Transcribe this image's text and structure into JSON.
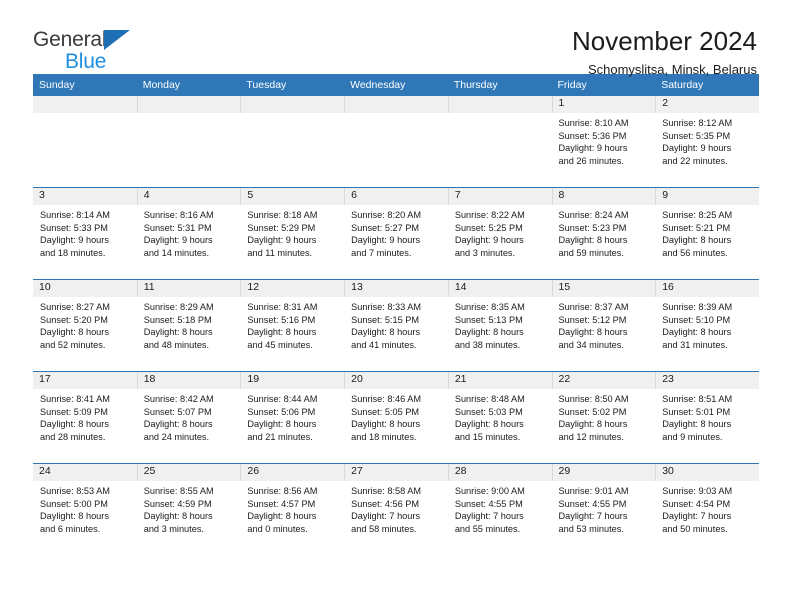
{
  "brand": {
    "name_part1": "General",
    "name_part2": "Blue",
    "accent_color": "#1f6fb5",
    "blue_text_color": "#1f8fe0"
  },
  "header": {
    "title": "November 2024",
    "location": "Schomyslitsa, Minsk, Belarus"
  },
  "calendar": {
    "header_color": "#3077b8",
    "weekdays": [
      "Sunday",
      "Monday",
      "Tuesday",
      "Wednesday",
      "Thursday",
      "Friday",
      "Saturday"
    ],
    "weeks": [
      [
        {
          "day": "",
          "sunrise": "",
          "sunset": "",
          "daylight_1": "",
          "daylight_2": ""
        },
        {
          "day": "",
          "sunrise": "",
          "sunset": "",
          "daylight_1": "",
          "daylight_2": ""
        },
        {
          "day": "",
          "sunrise": "",
          "sunset": "",
          "daylight_1": "",
          "daylight_2": ""
        },
        {
          "day": "",
          "sunrise": "",
          "sunset": "",
          "daylight_1": "",
          "daylight_2": ""
        },
        {
          "day": "",
          "sunrise": "",
          "sunset": "",
          "daylight_1": "",
          "daylight_2": ""
        },
        {
          "day": "1",
          "sunrise": "Sunrise: 8:10 AM",
          "sunset": "Sunset: 5:36 PM",
          "daylight_1": "Daylight: 9 hours",
          "daylight_2": "and 26 minutes."
        },
        {
          "day": "2",
          "sunrise": "Sunrise: 8:12 AM",
          "sunset": "Sunset: 5:35 PM",
          "daylight_1": "Daylight: 9 hours",
          "daylight_2": "and 22 minutes."
        }
      ],
      [
        {
          "day": "3",
          "sunrise": "Sunrise: 8:14 AM",
          "sunset": "Sunset: 5:33 PM",
          "daylight_1": "Daylight: 9 hours",
          "daylight_2": "and 18 minutes."
        },
        {
          "day": "4",
          "sunrise": "Sunrise: 8:16 AM",
          "sunset": "Sunset: 5:31 PM",
          "daylight_1": "Daylight: 9 hours",
          "daylight_2": "and 14 minutes."
        },
        {
          "day": "5",
          "sunrise": "Sunrise: 8:18 AM",
          "sunset": "Sunset: 5:29 PM",
          "daylight_1": "Daylight: 9 hours",
          "daylight_2": "and 11 minutes."
        },
        {
          "day": "6",
          "sunrise": "Sunrise: 8:20 AM",
          "sunset": "Sunset: 5:27 PM",
          "daylight_1": "Daylight: 9 hours",
          "daylight_2": "and 7 minutes."
        },
        {
          "day": "7",
          "sunrise": "Sunrise: 8:22 AM",
          "sunset": "Sunset: 5:25 PM",
          "daylight_1": "Daylight: 9 hours",
          "daylight_2": "and 3 minutes."
        },
        {
          "day": "8",
          "sunrise": "Sunrise: 8:24 AM",
          "sunset": "Sunset: 5:23 PM",
          "daylight_1": "Daylight: 8 hours",
          "daylight_2": "and 59 minutes."
        },
        {
          "day": "9",
          "sunrise": "Sunrise: 8:25 AM",
          "sunset": "Sunset: 5:21 PM",
          "daylight_1": "Daylight: 8 hours",
          "daylight_2": "and 56 minutes."
        }
      ],
      [
        {
          "day": "10",
          "sunrise": "Sunrise: 8:27 AM",
          "sunset": "Sunset: 5:20 PM",
          "daylight_1": "Daylight: 8 hours",
          "daylight_2": "and 52 minutes."
        },
        {
          "day": "11",
          "sunrise": "Sunrise: 8:29 AM",
          "sunset": "Sunset: 5:18 PM",
          "daylight_1": "Daylight: 8 hours",
          "daylight_2": "and 48 minutes."
        },
        {
          "day": "12",
          "sunrise": "Sunrise: 8:31 AM",
          "sunset": "Sunset: 5:16 PM",
          "daylight_1": "Daylight: 8 hours",
          "daylight_2": "and 45 minutes."
        },
        {
          "day": "13",
          "sunrise": "Sunrise: 8:33 AM",
          "sunset": "Sunset: 5:15 PM",
          "daylight_1": "Daylight: 8 hours",
          "daylight_2": "and 41 minutes."
        },
        {
          "day": "14",
          "sunrise": "Sunrise: 8:35 AM",
          "sunset": "Sunset: 5:13 PM",
          "daylight_1": "Daylight: 8 hours",
          "daylight_2": "and 38 minutes."
        },
        {
          "day": "15",
          "sunrise": "Sunrise: 8:37 AM",
          "sunset": "Sunset: 5:12 PM",
          "daylight_1": "Daylight: 8 hours",
          "daylight_2": "and 34 minutes."
        },
        {
          "day": "16",
          "sunrise": "Sunrise: 8:39 AM",
          "sunset": "Sunset: 5:10 PM",
          "daylight_1": "Daylight: 8 hours",
          "daylight_2": "and 31 minutes."
        }
      ],
      [
        {
          "day": "17",
          "sunrise": "Sunrise: 8:41 AM",
          "sunset": "Sunset: 5:09 PM",
          "daylight_1": "Daylight: 8 hours",
          "daylight_2": "and 28 minutes."
        },
        {
          "day": "18",
          "sunrise": "Sunrise: 8:42 AM",
          "sunset": "Sunset: 5:07 PM",
          "daylight_1": "Daylight: 8 hours",
          "daylight_2": "and 24 minutes."
        },
        {
          "day": "19",
          "sunrise": "Sunrise: 8:44 AM",
          "sunset": "Sunset: 5:06 PM",
          "daylight_1": "Daylight: 8 hours",
          "daylight_2": "and 21 minutes."
        },
        {
          "day": "20",
          "sunrise": "Sunrise: 8:46 AM",
          "sunset": "Sunset: 5:05 PM",
          "daylight_1": "Daylight: 8 hours",
          "daylight_2": "and 18 minutes."
        },
        {
          "day": "21",
          "sunrise": "Sunrise: 8:48 AM",
          "sunset": "Sunset: 5:03 PM",
          "daylight_1": "Daylight: 8 hours",
          "daylight_2": "and 15 minutes."
        },
        {
          "day": "22",
          "sunrise": "Sunrise: 8:50 AM",
          "sunset": "Sunset: 5:02 PM",
          "daylight_1": "Daylight: 8 hours",
          "daylight_2": "and 12 minutes."
        },
        {
          "day": "23",
          "sunrise": "Sunrise: 8:51 AM",
          "sunset": "Sunset: 5:01 PM",
          "daylight_1": "Daylight: 8 hours",
          "daylight_2": "and 9 minutes."
        }
      ],
      [
        {
          "day": "24",
          "sunrise": "Sunrise: 8:53 AM",
          "sunset": "Sunset: 5:00 PM",
          "daylight_1": "Daylight: 8 hours",
          "daylight_2": "and 6 minutes."
        },
        {
          "day": "25",
          "sunrise": "Sunrise: 8:55 AM",
          "sunset": "Sunset: 4:59 PM",
          "daylight_1": "Daylight: 8 hours",
          "daylight_2": "and 3 minutes."
        },
        {
          "day": "26",
          "sunrise": "Sunrise: 8:56 AM",
          "sunset": "Sunset: 4:57 PM",
          "daylight_1": "Daylight: 8 hours",
          "daylight_2": "and 0 minutes."
        },
        {
          "day": "27",
          "sunrise": "Sunrise: 8:58 AM",
          "sunset": "Sunset: 4:56 PM",
          "daylight_1": "Daylight: 7 hours",
          "daylight_2": "and 58 minutes."
        },
        {
          "day": "28",
          "sunrise": "Sunrise: 9:00 AM",
          "sunset": "Sunset: 4:55 PM",
          "daylight_1": "Daylight: 7 hours",
          "daylight_2": "and 55 minutes."
        },
        {
          "day": "29",
          "sunrise": "Sunrise: 9:01 AM",
          "sunset": "Sunset: 4:55 PM",
          "daylight_1": "Daylight: 7 hours",
          "daylight_2": "and 53 minutes."
        },
        {
          "day": "30",
          "sunrise": "Sunrise: 9:03 AM",
          "sunset": "Sunset: 4:54 PM",
          "daylight_1": "Daylight: 7 hours",
          "daylight_2": "and 50 minutes."
        }
      ]
    ]
  }
}
